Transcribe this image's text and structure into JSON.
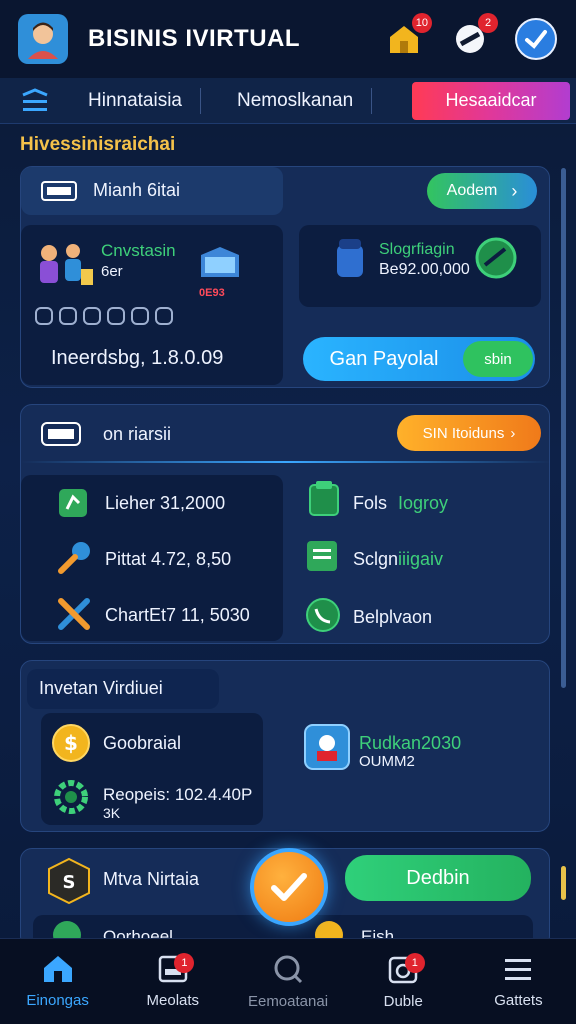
{
  "header": {
    "title": "BISINIS IVIRTUAL",
    "home_badge": "10",
    "coin_badge": "2"
  },
  "tabs": {
    "items": [
      "Hinnataisia",
      "Nemoslkanan"
    ],
    "active": "Hesaaidcar"
  },
  "section_heading": "Hivessinisraichai",
  "card1": {
    "title": "Mianh 6itai",
    "action_button": "Aodem",
    "left_tile": {
      "title": "Cnvstasin",
      "subtitle": "6er",
      "badge": "0E93",
      "footer": "Ineerdsbg, 1.8.0.09"
    },
    "right_tile": {
      "title": "Slogrfiagin",
      "value": "Be92.00,000"
    },
    "pay_button": "Gan Payolal",
    "pay_chip": "sbin"
  },
  "card2": {
    "title": "on riarsii",
    "action_button": "SIN Itoiduns",
    "stats": [
      {
        "label": "Lieher 31,2000"
      },
      {
        "label": "Pittat 4.72, 8,50"
      },
      {
        "label": "ChartEt7 11, 5030"
      }
    ],
    "links": [
      {
        "label_a": "Fols",
        "label_b": "Iogroy"
      },
      {
        "label_a": "Sclgn",
        "label_b": "iiigaiv"
      },
      {
        "label_a": "Belplvaon",
        "label_b": ""
      }
    ]
  },
  "card3": {
    "title": "Invetan Virdiuei",
    "left_items": [
      {
        "label": "Goobraial"
      },
      {
        "label": "Reopeis: 102.4.40P",
        "sub": "3K"
      }
    ],
    "right_title": "Rudkan2030",
    "right_sub": "OUMM2"
  },
  "card4": {
    "title": "Mtva Nirtaia",
    "button": "Dedbin",
    "peek_left": "Oorhoeel",
    "peek_right": "Eish"
  },
  "bottom_nav": [
    {
      "label": "Einongas",
      "active": true,
      "badge": ""
    },
    {
      "label": "Meolats",
      "active": false,
      "badge": "1"
    },
    {
      "label": "Eemoatanai",
      "active": false,
      "badge": ""
    },
    {
      "label": "Duble",
      "active": false,
      "badge": "1"
    },
    {
      "label": "Gattets",
      "active": false,
      "badge": ""
    }
  ]
}
